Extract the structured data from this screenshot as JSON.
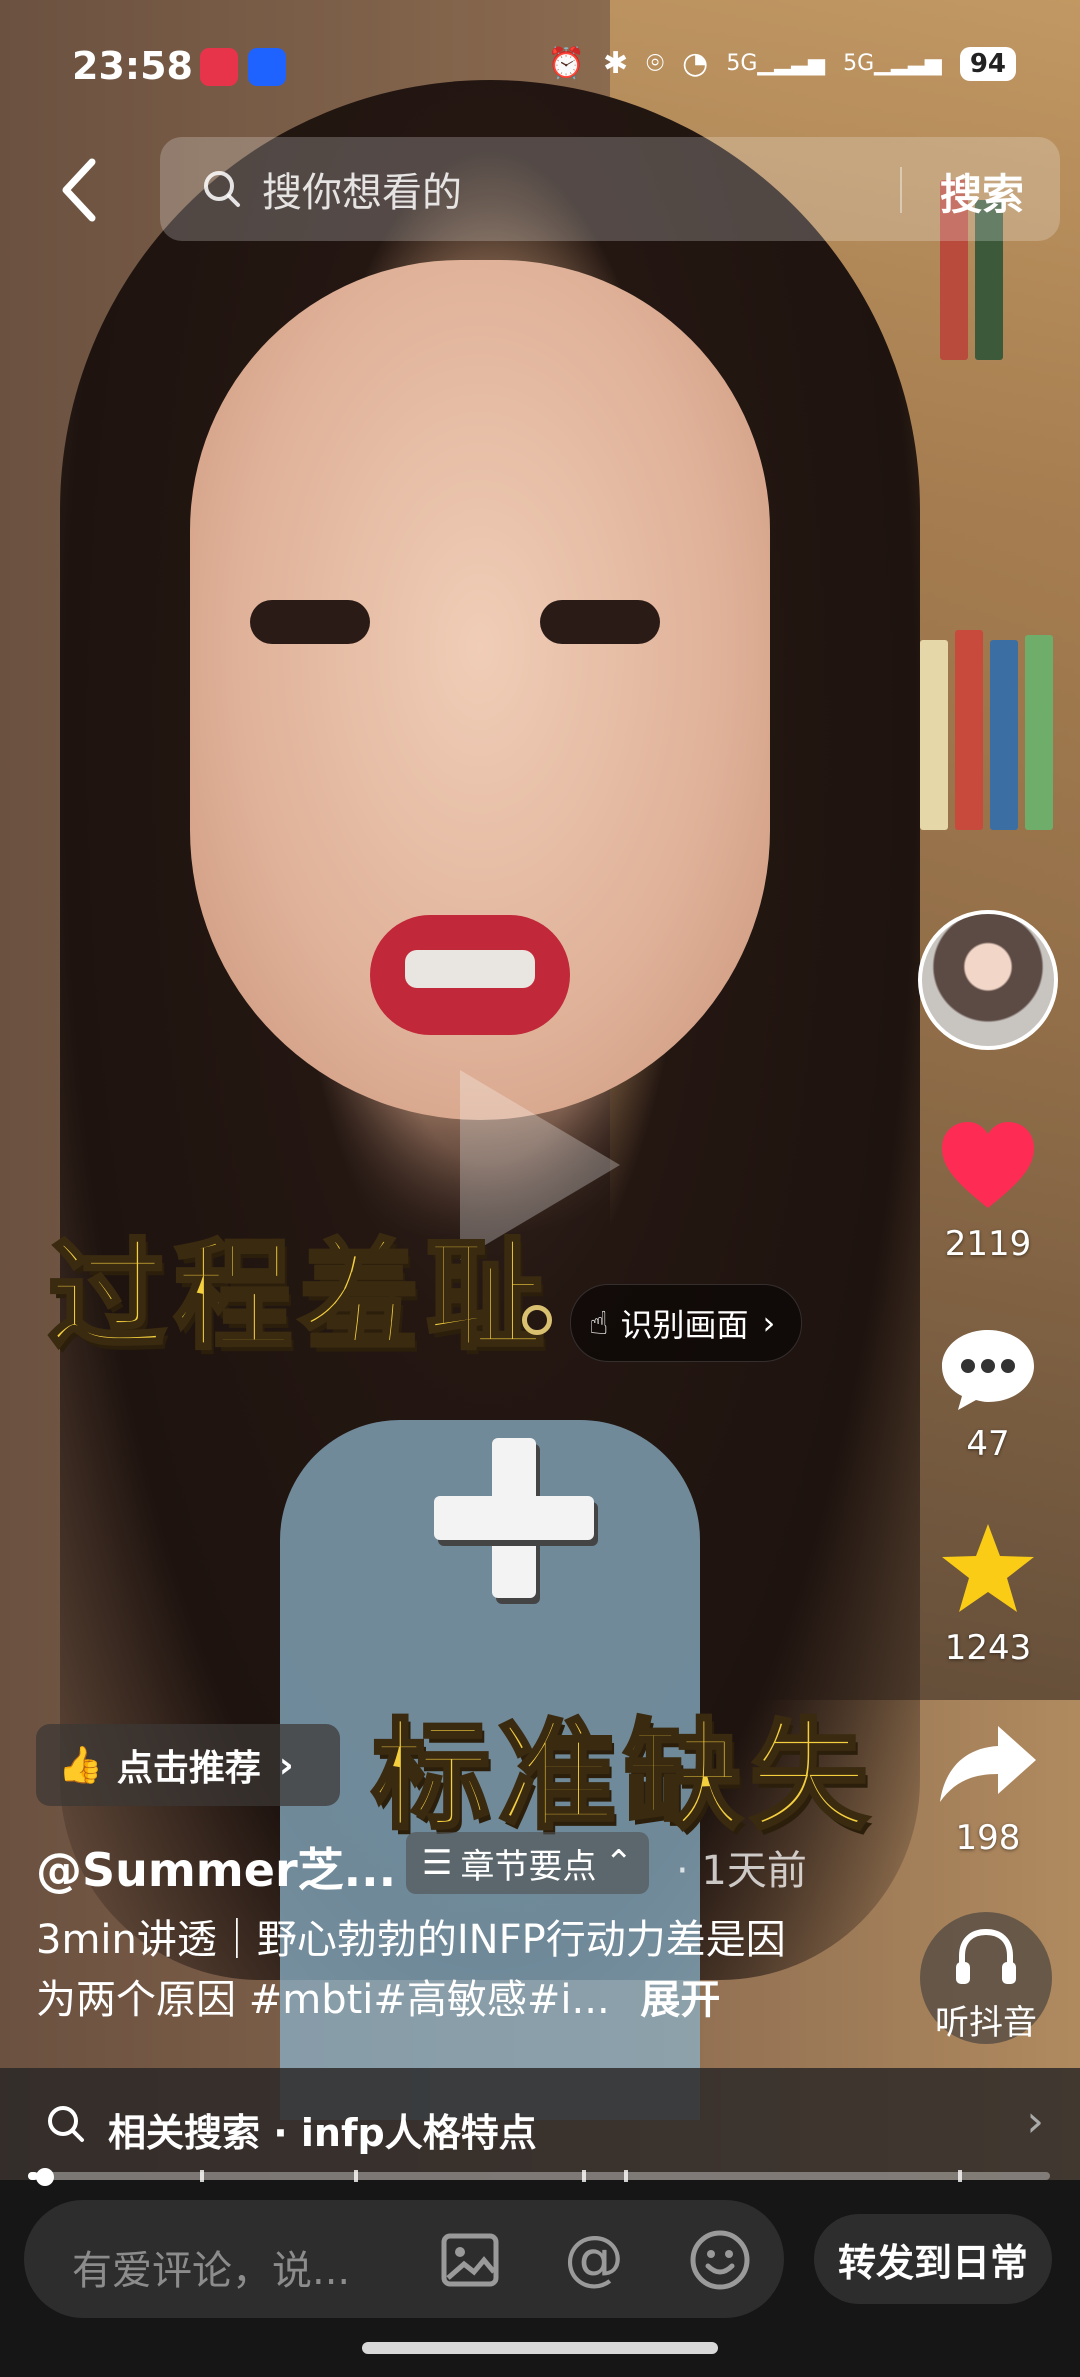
{
  "status_bar": {
    "time": "23:58",
    "battery": "94",
    "network_1": "5G",
    "network_2": "5G"
  },
  "search": {
    "placeholder": "搜你想看的",
    "button": "搜索"
  },
  "video_text": {
    "line1": "过程羞耻",
    "line2": "标准缺失"
  },
  "recognize": {
    "label": "识别画面"
  },
  "actions": {
    "likes": "2119",
    "comments": "47",
    "favorites": "1243",
    "shares": "198",
    "listen": "听抖音"
  },
  "recommend": {
    "label": "点击推荐"
  },
  "post": {
    "author": "@Summer芝...",
    "chapter": "章节要点",
    "time_ago": "· 1天前",
    "description": "3min讲透｜野心勃勃的INFP行动力差是因为两个原因 #mbti#高敏感#i...",
    "expand": "展开"
  },
  "related_search": {
    "label": "相关搜索 · infp人格特点"
  },
  "playback": {
    "progress": 0.01
  },
  "comment_bar": {
    "placeholder": "有爱评论，说...",
    "share_daily": "转发到日常"
  },
  "colors": {
    "like": "#fe2c55",
    "favorite": "#facc15",
    "caption": "#f4cf3e"
  }
}
